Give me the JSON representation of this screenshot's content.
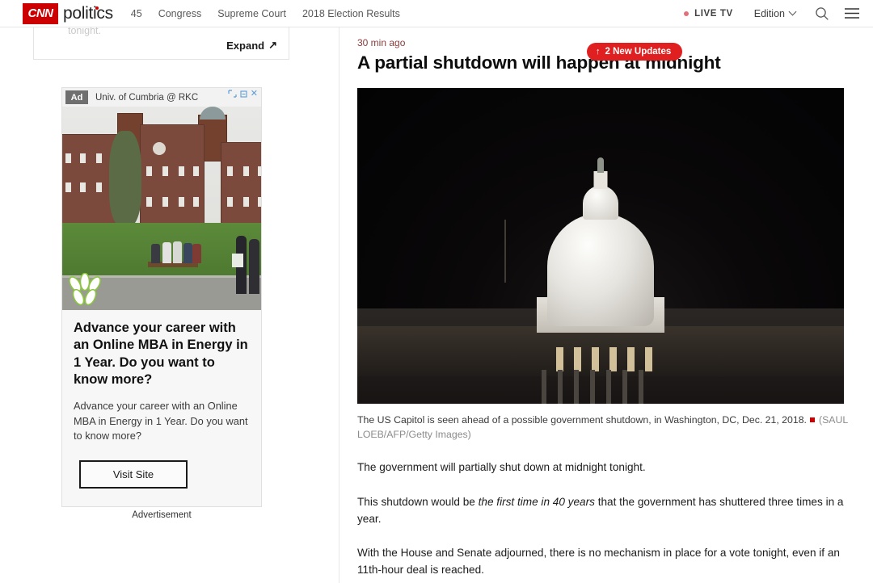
{
  "header": {
    "logo_text": "CNN",
    "section": "politics",
    "nav_items": [
      {
        "label": "45"
      },
      {
        "label": "Congress"
      },
      {
        "label": "Supreme Court"
      },
      {
        "label": "2018 Election Results"
      }
    ],
    "live_tv": "LIVE TV",
    "edition": "Edition",
    "search_icon": "search-icon",
    "menu_icon": "hamburger-menu-icon",
    "brand_color": "#cc0000"
  },
  "sidebar": {
    "clipped_card": {
      "faded_text": "tonight.",
      "expand_label": "Expand",
      "expand_arrow": "↗"
    },
    "ad": {
      "badge": "Ad",
      "advertiser": "Univ. of Cumbria @ RKC",
      "adchoices_icon": "adchoices-icon",
      "info_icon": "ad-info-icon",
      "close_icon": "✕",
      "headline": "Advance your career with an Online MBA in Energy in 1 Year. Do you want to know more?",
      "description": "Advance your career with an Online MBA in Energy in 1 Year. Do you want to know more?",
      "cta_label": "Visit Site",
      "disclosure": "Advertisement"
    }
  },
  "article": {
    "timestamp": "30 min ago",
    "updates_badge": {
      "arrow": "↑",
      "label": "2 New Updates",
      "color": "#e02020"
    },
    "headline": "A partial shutdown will happen at midnight",
    "caption_main": "The US Capitol is seen ahead of a possible government shutdown, in Washington, DC, Dec. 21, 2018.",
    "caption_credit": "(SAUL LOEB/AFP/Getty Images)",
    "paragraphs": [
      {
        "text": "The government will partially shut down at midnight tonight."
      },
      {
        "pre": "This shutdown would be ",
        "em": "the first time in 40 years",
        "post": " that the government has shuttered three times in a year."
      },
      {
        "text": "With the House and Senate adjourned, there is no mechanism in place for a vote tonight, even if an 11th-hour deal is reached."
      }
    ]
  }
}
